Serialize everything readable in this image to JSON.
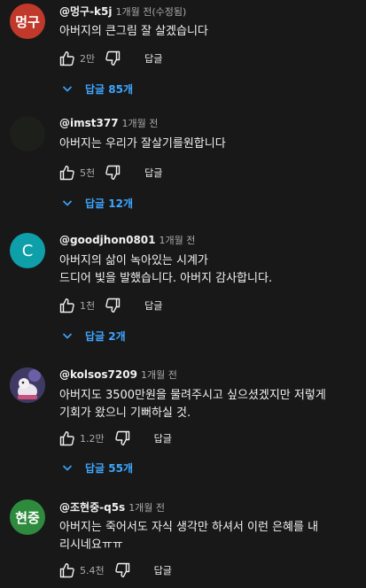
{
  "comments": [
    {
      "avatar_text": "멍구",
      "avatar_color": "#c0392b",
      "author": "@멍구-k5j",
      "time": "1개월 전(수정됨)",
      "lines": [
        "아버지의 큰그림 잘 살겠습니다"
      ],
      "likes": "2만",
      "reply_label": "답글",
      "replies_label": "답글 85개"
    },
    {
      "avatar_text": "",
      "avatar_color": "#1d1f1b",
      "author": "@imst377",
      "time": "1개월 전",
      "lines": [
        "아버지는 우리가 잘살기를원합니다"
      ],
      "likes": "5천",
      "reply_label": "답글",
      "replies_label": "답글 12개"
    },
    {
      "avatar_text": "C",
      "avatar_color": "#0f9fa8",
      "author": "@goodjhon0801",
      "time": "1개월 전",
      "lines": [
        "아버지의 삶이 녹아있는 시계가",
        "드디어 빛을 발했습니다. 아버지 감사합니다."
      ],
      "likes": "1천",
      "reply_label": "답글",
      "replies_label": "답글 2개"
    },
    {
      "avatar_text": "",
      "avatar_color": "#3f3a63",
      "author": "@kolsos7209",
      "time": "1개월 전",
      "lines": [
        "아버지도 3500만원을 물려주시고 싶으셨겠지만 저렇게",
        "기회가 왔으니 기뻐하실 것."
      ],
      "likes": "1.2만",
      "reply_label": "답글",
      "replies_label": "답글 55개"
    },
    {
      "avatar_text": "현중",
      "avatar_color": "#2e8b3e",
      "author": "@조현중-q5s",
      "time": "1개월 전",
      "lines": [
        "아버지는 죽어서도 자식 생각만 하셔서 이런 은혜를 내",
        "리시네요ㅠㅠ"
      ],
      "likes": "5.4천",
      "reply_label": "답글"
    }
  ],
  "icons": {
    "like": "thumb-up-icon",
    "dislike": "thumb-down-icon",
    "expand": "chevron-down-icon"
  }
}
